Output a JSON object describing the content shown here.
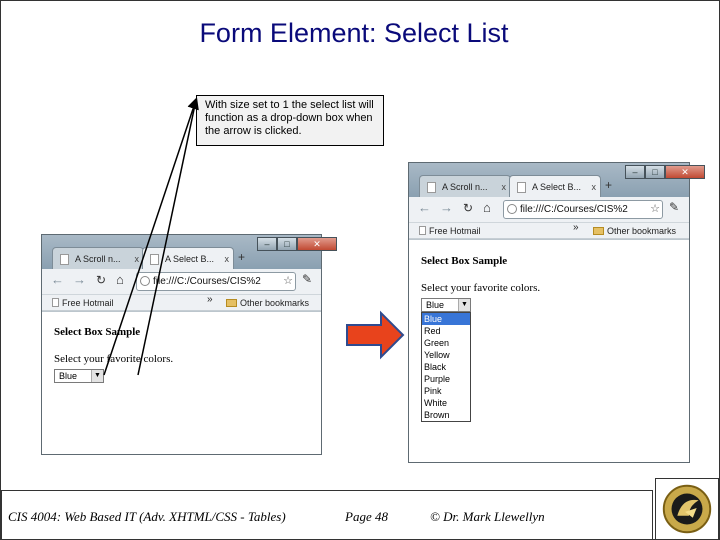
{
  "slide": {
    "title": "Form Element: Select List",
    "callout": "With size set to 1 the select list will function as a drop-down box when the arrow is clicked."
  },
  "browser": {
    "tab1": "A Scroll n...",
    "tab2": "A Select B...",
    "tab_close": "x",
    "new_tab": "+",
    "address": "file:///C:/Courses/CIS%2",
    "bookmark1": "Free Hotmail",
    "bookmark_chevron": "»",
    "bookmark2": "Other bookmarks",
    "heading": "Select Box Sample",
    "label": "Select your favorite colors.",
    "selected": "Blue",
    "options": [
      "Blue",
      "Red",
      "Green",
      "Yellow",
      "Black",
      "Purple",
      "Pink",
      "White",
      "Brown"
    ]
  },
  "footer": {
    "course": "CIS 4004: Web Based IT (Adv. XHTML/CSS - Tables)",
    "page": "Page 48",
    "author": "© Dr. Mark Llewellyn"
  },
  "colors": {
    "title": "#0a0a7a",
    "arrow_fill": "#e8431c",
    "arrow_stroke": "#2f4b8f",
    "highlight": "#3875d7"
  }
}
